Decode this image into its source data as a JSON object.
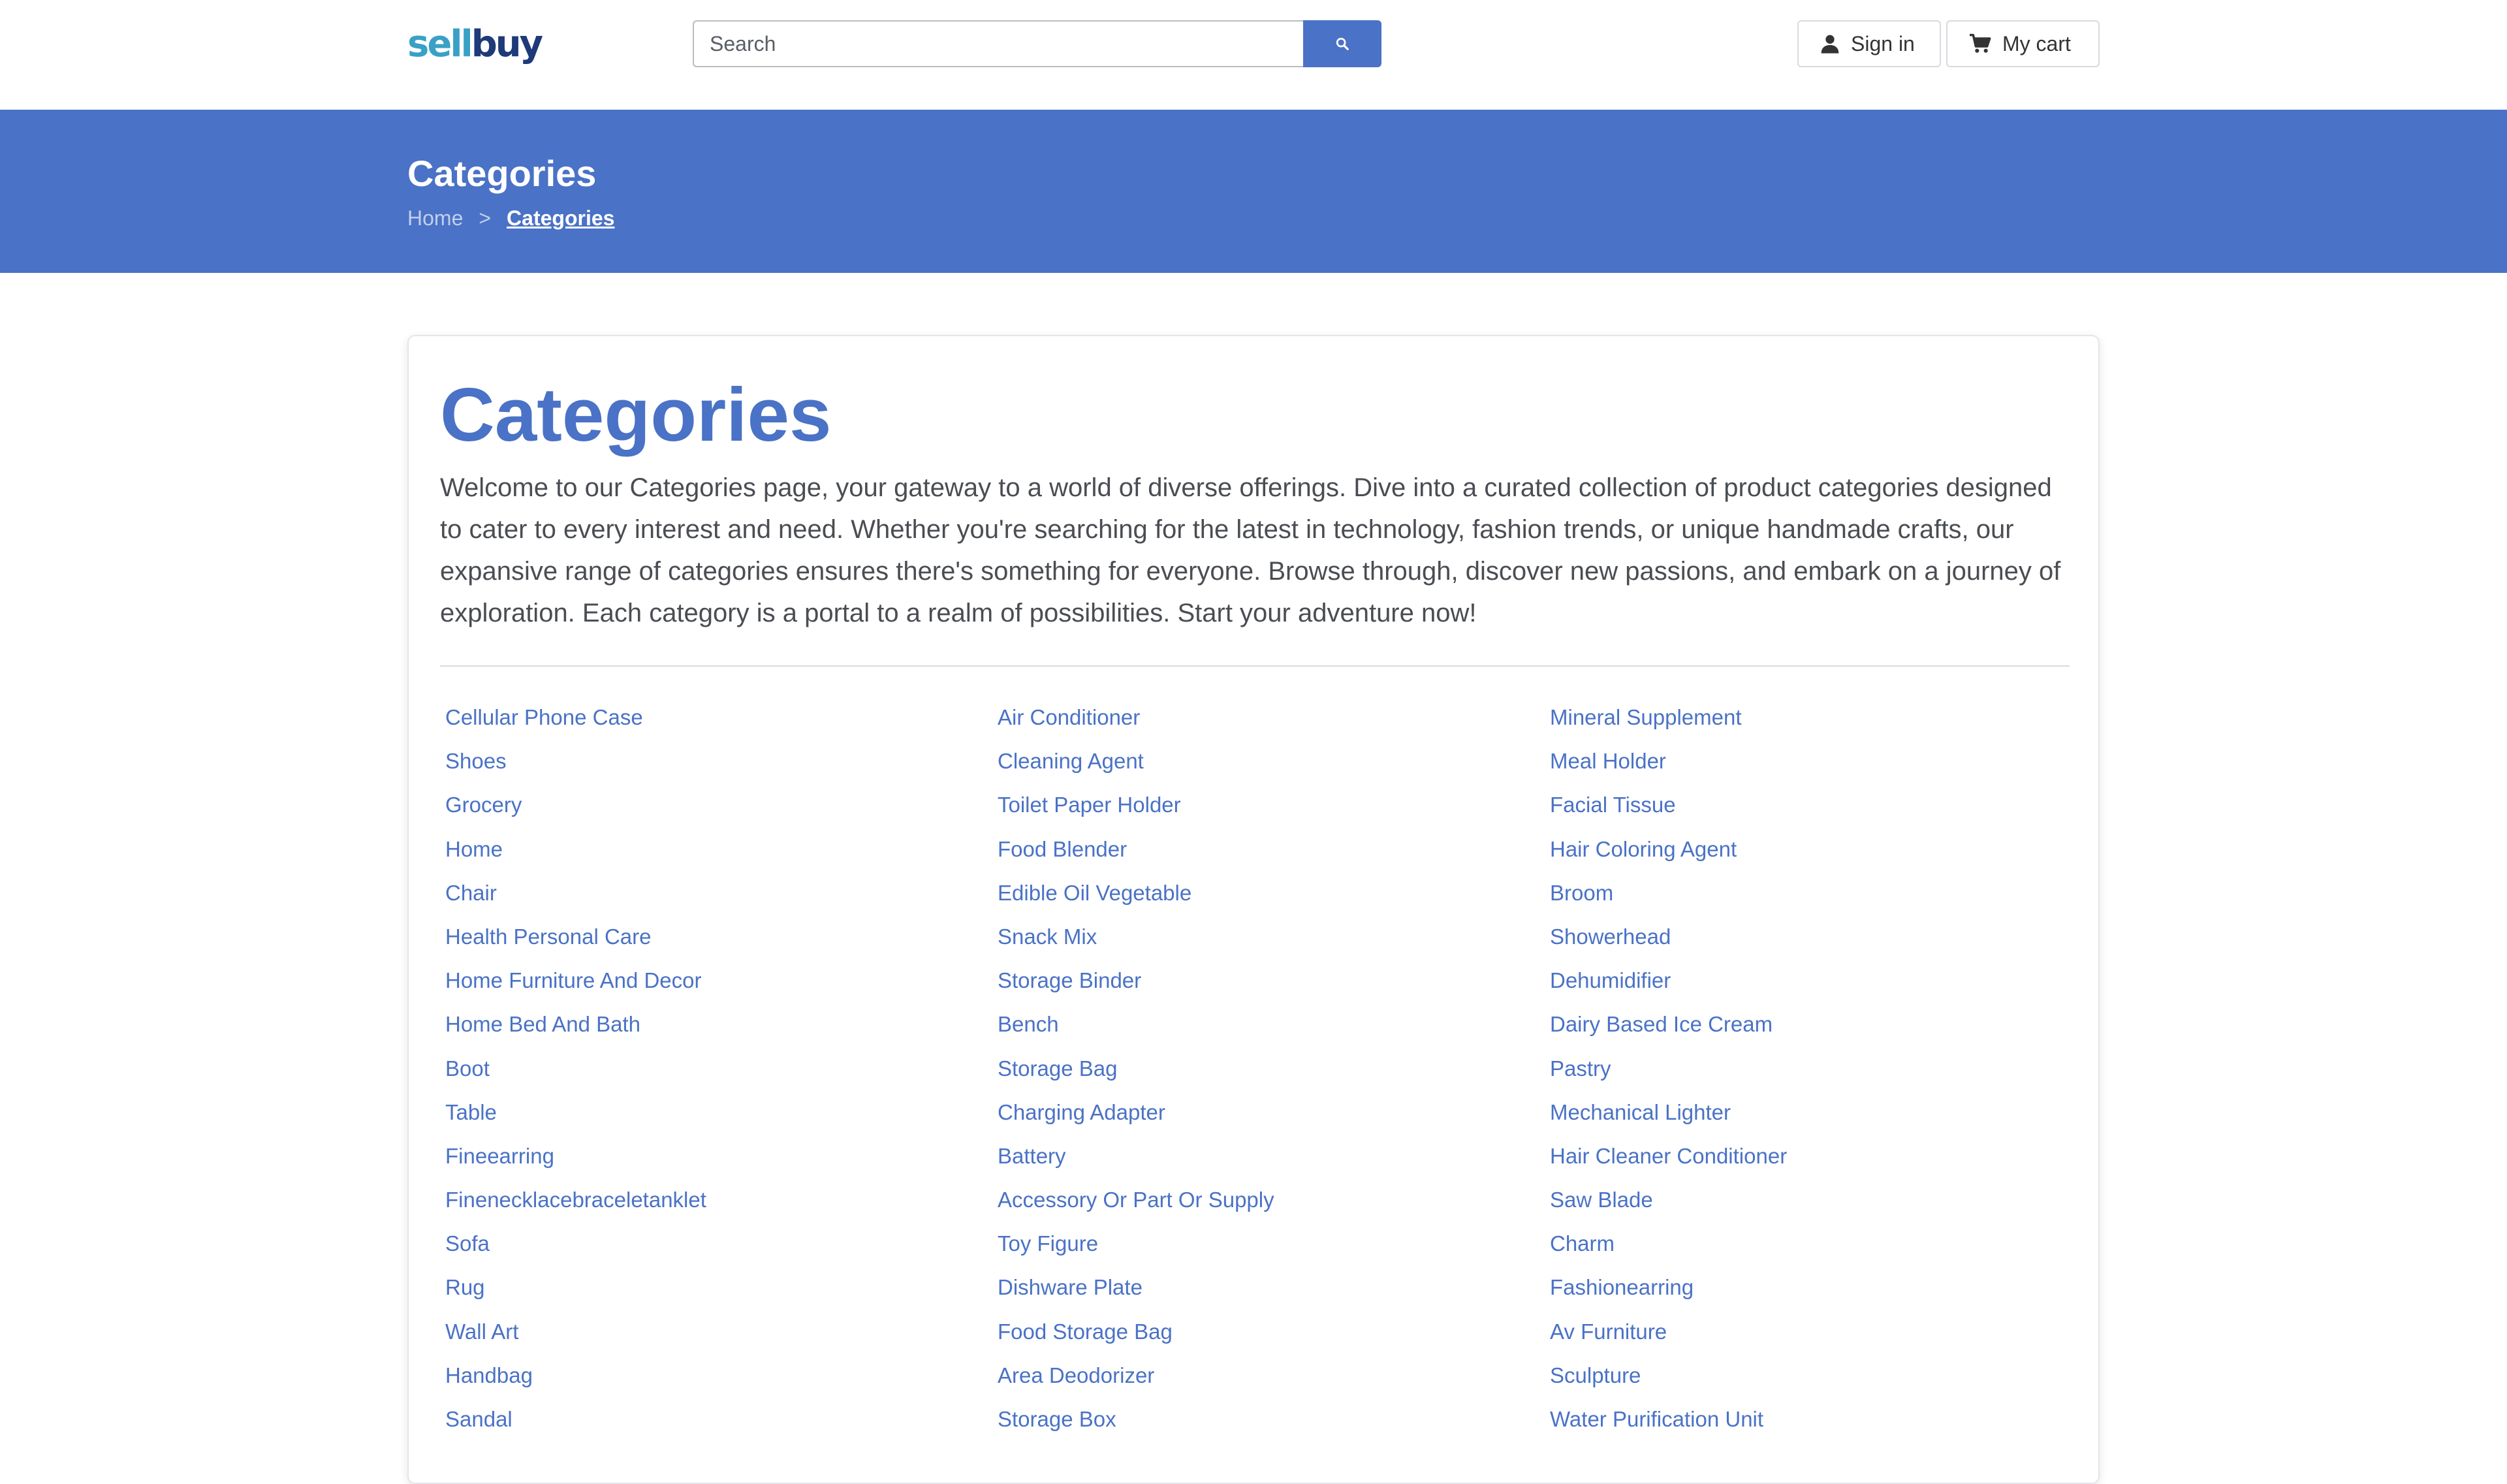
{
  "header": {
    "logo": {
      "part1": "sell",
      "part2": "buy"
    },
    "search": {
      "placeholder": "Search"
    },
    "signin_label": "Sign in",
    "cart_label": "My cart"
  },
  "banner": {
    "title": "Categories",
    "breadcrumb": {
      "home": "Home",
      "separator": ">",
      "current": "Categories"
    }
  },
  "main": {
    "title": "Categories",
    "description": "Welcome to our Categories page, your gateway to a world of diverse offerings. Dive into a curated collection of product categories designed to cater to every interest and need. Whether you're searching for the latest in technology, fashion trends, or unique handmade crafts, our expansive range of categories ensures there's something for everyone. Browse through, discover new passions, and embark on a journey of exploration. Each category is a portal to a realm of possibilities. Start your adventure now!",
    "columns": [
      [
        "Cellular Phone Case",
        "Shoes",
        "Grocery",
        "Home",
        "Chair",
        "Health Personal Care",
        "Home Furniture And Decor",
        "Home Bed And Bath",
        "Boot",
        "Table",
        "Fineearring",
        "Finenecklacebraceletanklet",
        "Sofa",
        "Rug",
        "Wall Art",
        "Handbag",
        "Sandal"
      ],
      [
        "Air Conditioner",
        "Cleaning Agent",
        "Toilet Paper Holder",
        "Food Blender",
        "Edible Oil Vegetable",
        "Snack Mix",
        "Storage Binder",
        "Bench",
        "Storage Bag",
        "Charging Adapter",
        "Battery",
        "Accessory Or Part Or Supply",
        "Toy Figure",
        "Dishware Plate",
        "Food Storage Bag",
        "Area Deodorizer",
        "Storage Box"
      ],
      [
        "Mineral Supplement",
        "Meal Holder",
        "Facial Tissue",
        "Hair Coloring Agent",
        "Broom",
        "Showerhead",
        "Dehumidifier",
        "Dairy Based Ice Cream",
        "Pastry",
        "Mechanical Lighter",
        "Hair Cleaner Conditioner",
        "Saw Blade",
        "Charm",
        "Fashionearring",
        "Av Furniture",
        "Sculpture",
        "Water Purification Unit"
      ]
    ]
  },
  "colors": {
    "accent": "#4a72c6",
    "logo_light": "#39a1c6",
    "logo_dark": "#1e3a78"
  },
  "icons": {
    "search": "search-icon",
    "user": "user-icon",
    "cart": "cart-icon"
  }
}
